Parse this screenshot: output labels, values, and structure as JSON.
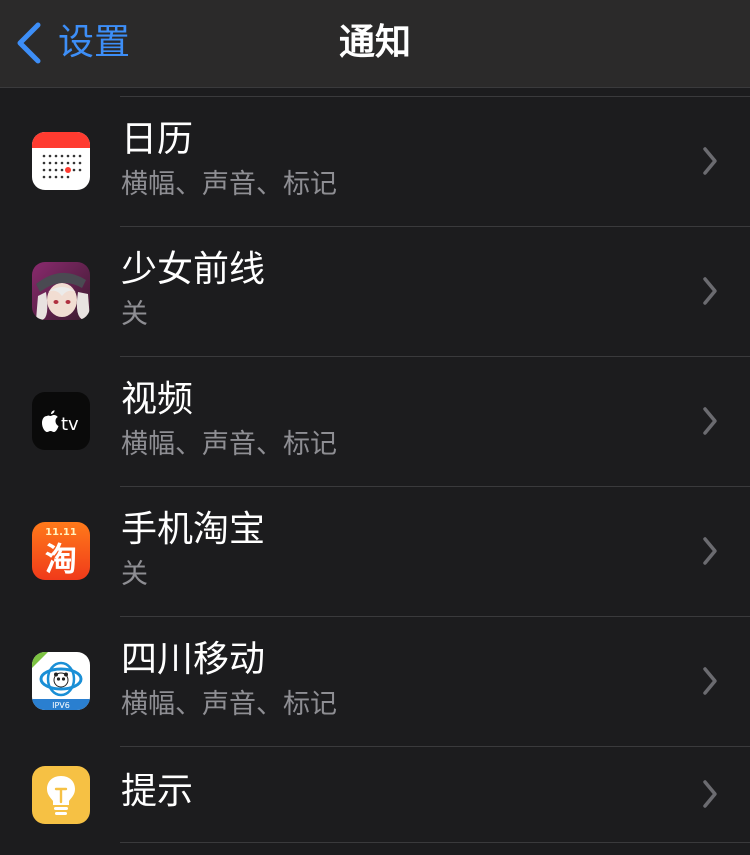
{
  "nav": {
    "back_label": "设置",
    "title": "通知"
  },
  "apps": [
    {
      "name": "日历",
      "status": "横幅、声音、标记",
      "icon": "calendar-icon"
    },
    {
      "name": "少女前线",
      "status": "关",
      "icon": "girls-frontline-icon"
    },
    {
      "name": "视频",
      "status": "横幅、声音、标记",
      "icon": "apple-tv-icon",
      "icon_text": "tv"
    },
    {
      "name": "手机淘宝",
      "status": "关",
      "icon": "taobao-icon",
      "icon_text": "淘",
      "icon_badge": "11.11"
    },
    {
      "name": "四川移动",
      "status": "横幅、声音、标记",
      "icon": "sichuan-mobile-icon",
      "icon_badge": "IPV6"
    },
    {
      "name": "提示",
      "icon": "tips-icon"
    }
  ],
  "colors": {
    "accent": "#3d8ef7",
    "background": "#1c1c1e",
    "secondary_text": "#8e8e93"
  }
}
